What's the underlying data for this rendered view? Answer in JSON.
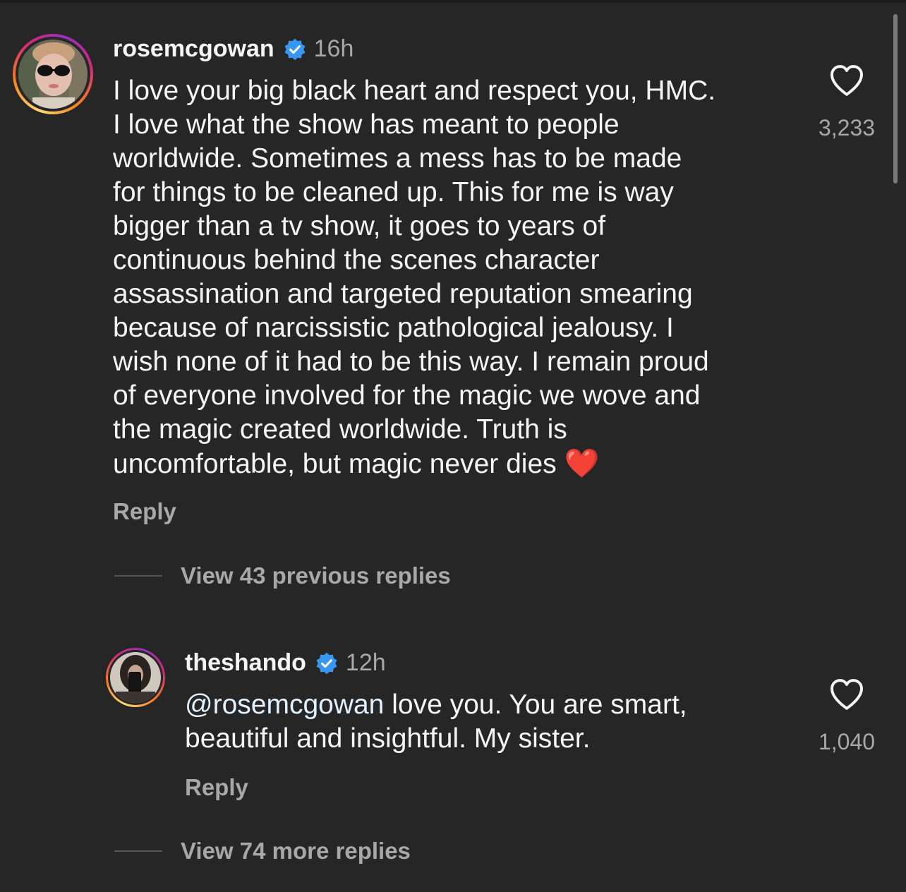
{
  "comments": [
    {
      "username": "rosemcgowan",
      "verified": true,
      "time": "16h",
      "text_lines": [
        "I love your big black heart and respect you, HMC.",
        "I love what the show has meant to people",
        "worldwide. Sometimes a mess has to be made",
        "for things to be cleaned up. This for me is way",
        "bigger than a tv show, it goes to years of",
        "continuous behind the scenes character",
        "assassination and targeted reputation smearing",
        "because of narcissistic pathological jealousy. I",
        "wish none of it had to be this way. I remain proud",
        "of everyone involved for the magic we wove and",
        "the magic created worldwide. Truth is",
        "uncomfortable, but magic never dies"
      ],
      "emoji": "❤️",
      "reply_label": "Reply",
      "like_count": "3,233",
      "view_replies_label": "View 43 previous replies"
    },
    {
      "username": "theshando",
      "verified": true,
      "time": "12h",
      "mention": "@rosemcgowan",
      "text_line_1_rest": " love you. You are smart,",
      "text_line_2": "beautiful and insightful. My sister.",
      "reply_label": "Reply",
      "like_count": "1,040",
      "view_replies_label": "View 74 more replies"
    }
  ],
  "icons": {
    "verified": "verified-badge-icon",
    "like": "heart-outline-icon"
  },
  "colors": {
    "background": "#262626",
    "verified_blue": "#3897f0",
    "muted_text": "#a8a8a8"
  }
}
